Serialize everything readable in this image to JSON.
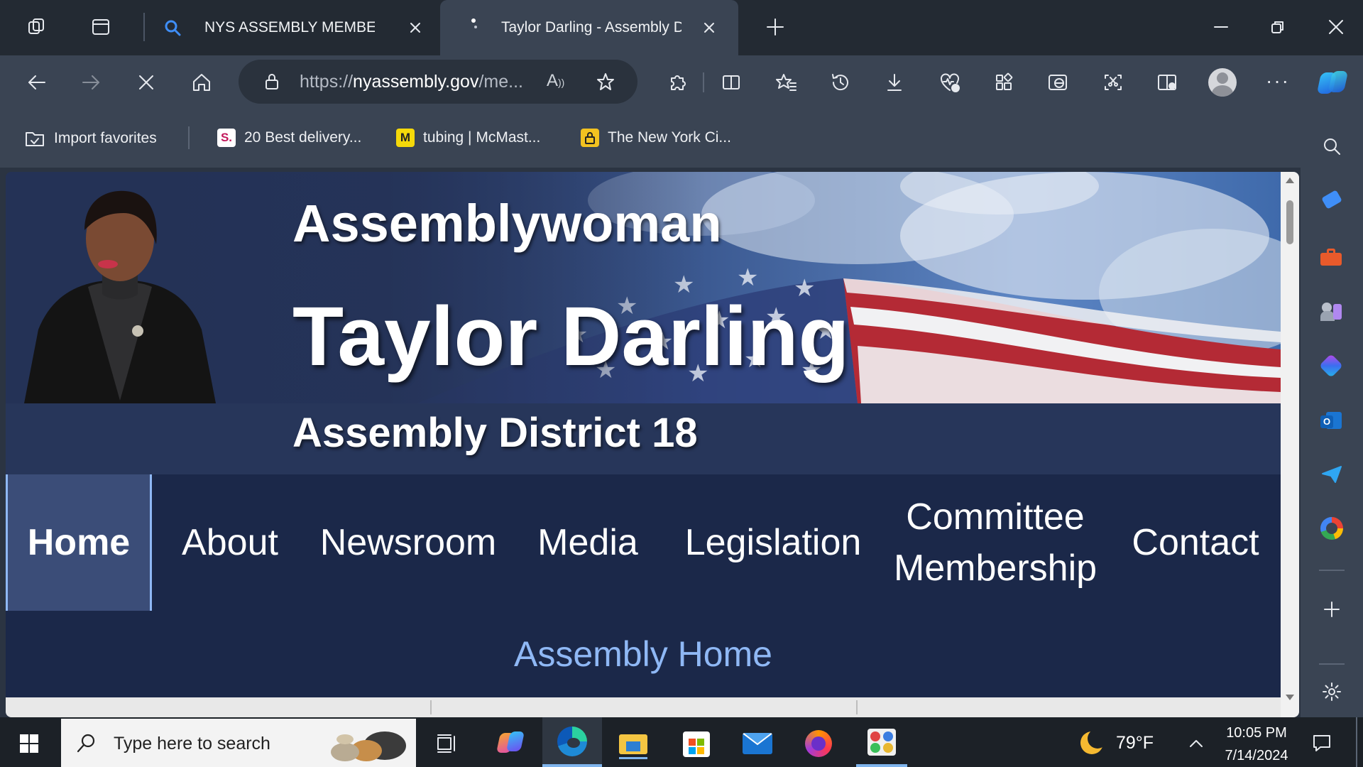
{
  "browser": {
    "tabs": [
      {
        "title": "NYS ASSEMBLY MEMBERS"
      },
      {
        "title": "Taylor Darling - Assembly D"
      }
    ],
    "address": {
      "scheme": "https://",
      "domain": "nyassembly.gov",
      "path": "/me..."
    },
    "favorites": [
      {
        "label": "Import favorites"
      },
      {
        "label": "20 Best delivery...",
        "icon": "S."
      },
      {
        "label": "tubing | McMast...",
        "icon": "M"
      },
      {
        "label": "The New York Ci..."
      }
    ]
  },
  "page": {
    "title_prefix": "Assemblywoman",
    "name": "Taylor Darling",
    "district": "Assembly District 18",
    "nav": [
      {
        "label": "Home"
      },
      {
        "label": "About"
      },
      {
        "label": "Newsroom"
      },
      {
        "label": "Media"
      },
      {
        "label": "Legislation"
      },
      {
        "label": "Committee Membership"
      },
      {
        "label": "Contact"
      }
    ],
    "active_nav": "Home",
    "link": "Assembly Home"
  },
  "taskbar": {
    "search_placeholder": "Type here to search",
    "weather": "79°F",
    "time": "10:05 PM",
    "date": "7/14/2024"
  },
  "colors": {
    "page_bg": "#243256",
    "nav_bg": "#1b2849",
    "active_nav": "#3b4d78",
    "link": "#8fb8f5"
  }
}
